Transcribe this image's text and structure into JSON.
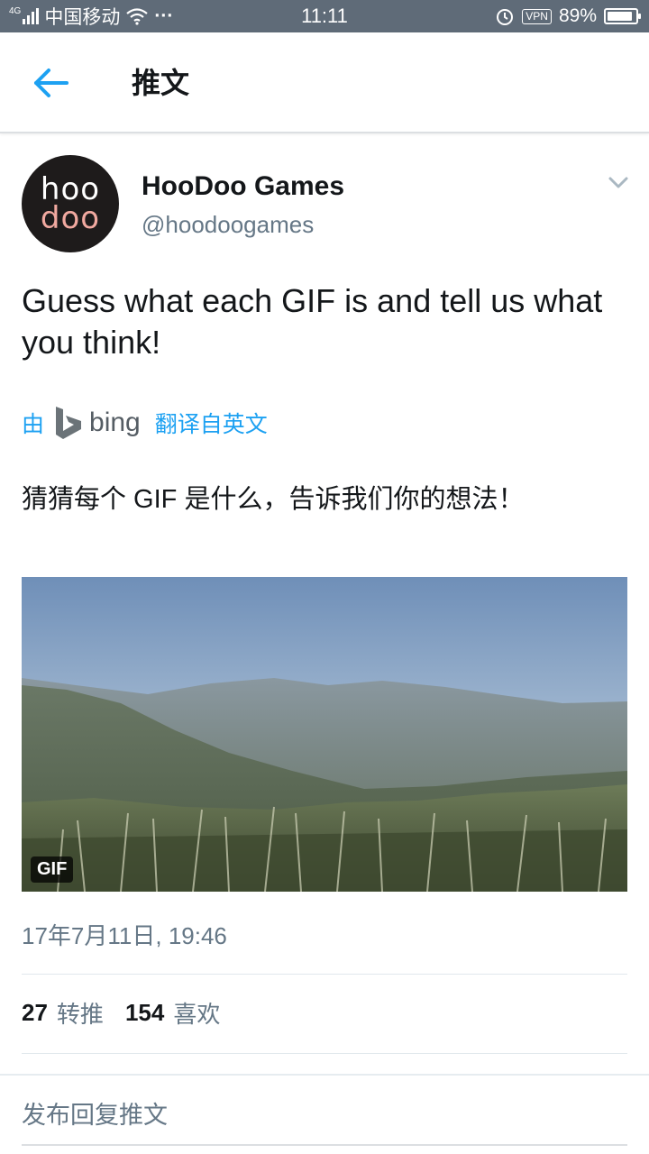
{
  "status_bar": {
    "network": "4G",
    "carrier": "中国移动",
    "more": "···",
    "time": "11:11",
    "vpn": "VPN",
    "battery_text": "89%",
    "battery_level": 0.89
  },
  "header": {
    "title": "推文"
  },
  "tweet": {
    "avatar": {
      "line1": "hoo",
      "line2": "doo"
    },
    "display_name": "HooDoo Games",
    "handle": "@hoodoogames",
    "text": "Guess what each GIF is and tell us what you think!",
    "translate": {
      "by": "由",
      "bing": "bing",
      "link": "翻译自英文"
    },
    "translated_text": "猜猜每个 GIF 是什么，告诉我们你的想法！",
    "media": {
      "badge": "GIF"
    },
    "timestamp": "17年7月11日, 19:46",
    "retweets": {
      "count": "27",
      "label": "转推"
    },
    "likes": {
      "count": "154",
      "label": "喜欢"
    }
  },
  "reply": {
    "placeholder": "发布回复推文"
  },
  "colors": {
    "accent": "#1da1f2",
    "status_bar": "#5f6b78",
    "secondary_text": "#657786"
  }
}
